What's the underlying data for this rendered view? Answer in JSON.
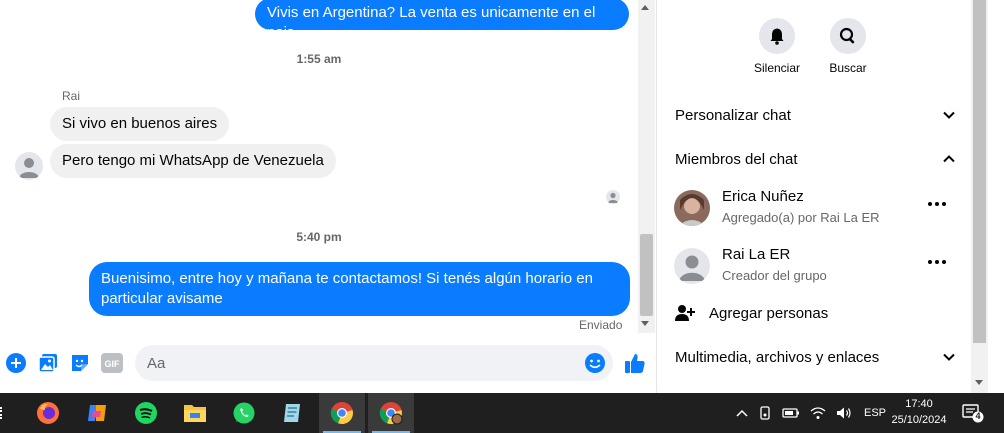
{
  "chat": {
    "messages": {
      "out_top": "Vivis en Argentina? La venta es unicamente en el pais",
      "ts1": "1:55 am",
      "sender": "Rai",
      "in1": "Si vivo en buenos aires",
      "in2": "Pero tengo mi WhatsApp de Venezuela",
      "ts2": "5:40 pm",
      "out_line1": "Buenisimo, entre hoy y mañana te contactamos! Si tenés algún horario en",
      "out_line2": "particular avisame",
      "status": "Enviado"
    },
    "composer": {
      "placeholder": "Aa",
      "icons": [
        "plus-circle-icon",
        "image-icon",
        "sticker-icon",
        "gif-icon",
        "emoji-icon",
        "like-icon"
      ],
      "gif_label": "GIF"
    },
    "accent": "#0a7cff"
  },
  "panel": {
    "actions": [
      {
        "label": "Silenciar",
        "icon": "bell-icon"
      },
      {
        "label": "Buscar",
        "icon": "search-icon"
      }
    ],
    "customize_chat": "Personalizar chat",
    "members_title": "Miembros del chat",
    "members": [
      {
        "name": "Erica Nuñez",
        "subtitle": "Agregado(a) por Rai La ER"
      },
      {
        "name": "Rai La ER",
        "subtitle": "Creador del grupo"
      }
    ],
    "add_people": "Agregar personas",
    "media": "Multimedia, archivos y enlaces"
  },
  "taskbar": {
    "apps": [
      "firefox-icon",
      "copilot-icon",
      "spotify-icon",
      "file-explorer-icon",
      "whatsapp-icon",
      "notes-icon",
      "chrome-icon",
      "chrome-profile-icon"
    ],
    "language": "ESP",
    "time": "17:40",
    "date": "25/10/2024",
    "notifications": "4"
  }
}
